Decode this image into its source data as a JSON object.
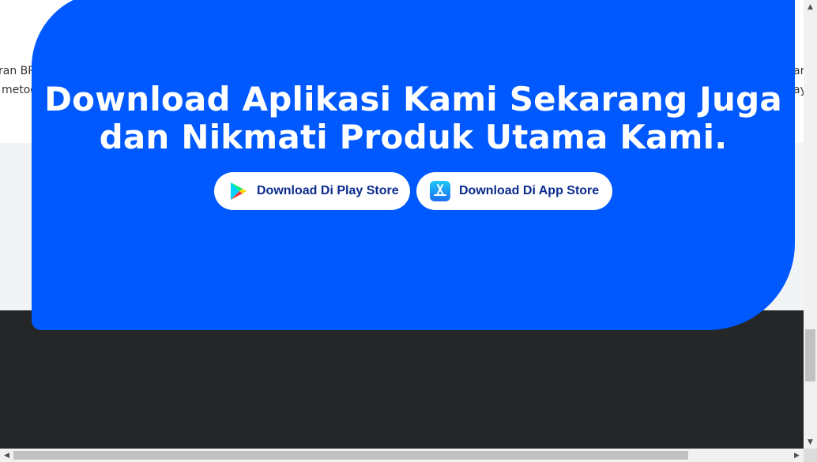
{
  "side_text": {
    "left_line1": "ran BP",
    "left_line2": "metod",
    "right_line1": "ara",
    "right_line2": "ay"
  },
  "banner": {
    "headline_line1": "Download Aplikasi Kami Sekarang Juga",
    "headline_line2": "dan Nikmati Produk Utama Kami.",
    "color": "#0059ff"
  },
  "buttons": {
    "play_store": {
      "label": "Download Di Play Store",
      "icon": "google-play-icon"
    },
    "app_store": {
      "label": "Download Di App Store",
      "icon": "app-store-icon"
    }
  },
  "scrollbars": {
    "up_arrow": "▲",
    "down_arrow": "▼",
    "left_arrow": "◀",
    "right_arrow": "▶"
  },
  "colors": {
    "footer": "#252628",
    "section_bg": "#f2f3f5",
    "button_text": "#0a2a8c"
  }
}
